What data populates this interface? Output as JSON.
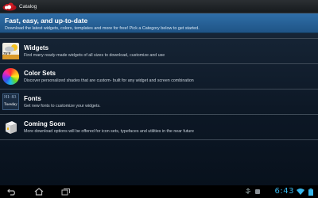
{
  "app": {
    "title": "Catalog"
  },
  "header": {
    "title": "Fast, easy, and up-to-date",
    "description": "Download the latest widgets, colors, templates and more for free! Pick a Category below to get started."
  },
  "items": [
    {
      "title": "Widgets",
      "description": "Find many ready-made widgets of all sizes to download, customize and use",
      "icon": "widgets-weather-icon",
      "icon_text": "75°F"
    },
    {
      "title": "Color Sets",
      "description": "Discover personalized shades that are custom- built for any widget and screen combination",
      "icon": "color-wheel-icon"
    },
    {
      "title": "Fonts",
      "description": "Get new fonts to customize your widgets.",
      "icon": "fonts-icon",
      "icon_text_top": "HI: 83",
      "icon_text_bottom": "Tuesday"
    },
    {
      "title": "Coming Soon",
      "description": "More download options will be offered for icon sets, typefaces and utilities in the near future",
      "icon": "coming-soon-box-icon"
    }
  ],
  "status_bar": {
    "time": "6:43"
  },
  "colors": {
    "header": "#2a649d",
    "clock": "#38b7ec",
    "background": "#0d1826"
  }
}
